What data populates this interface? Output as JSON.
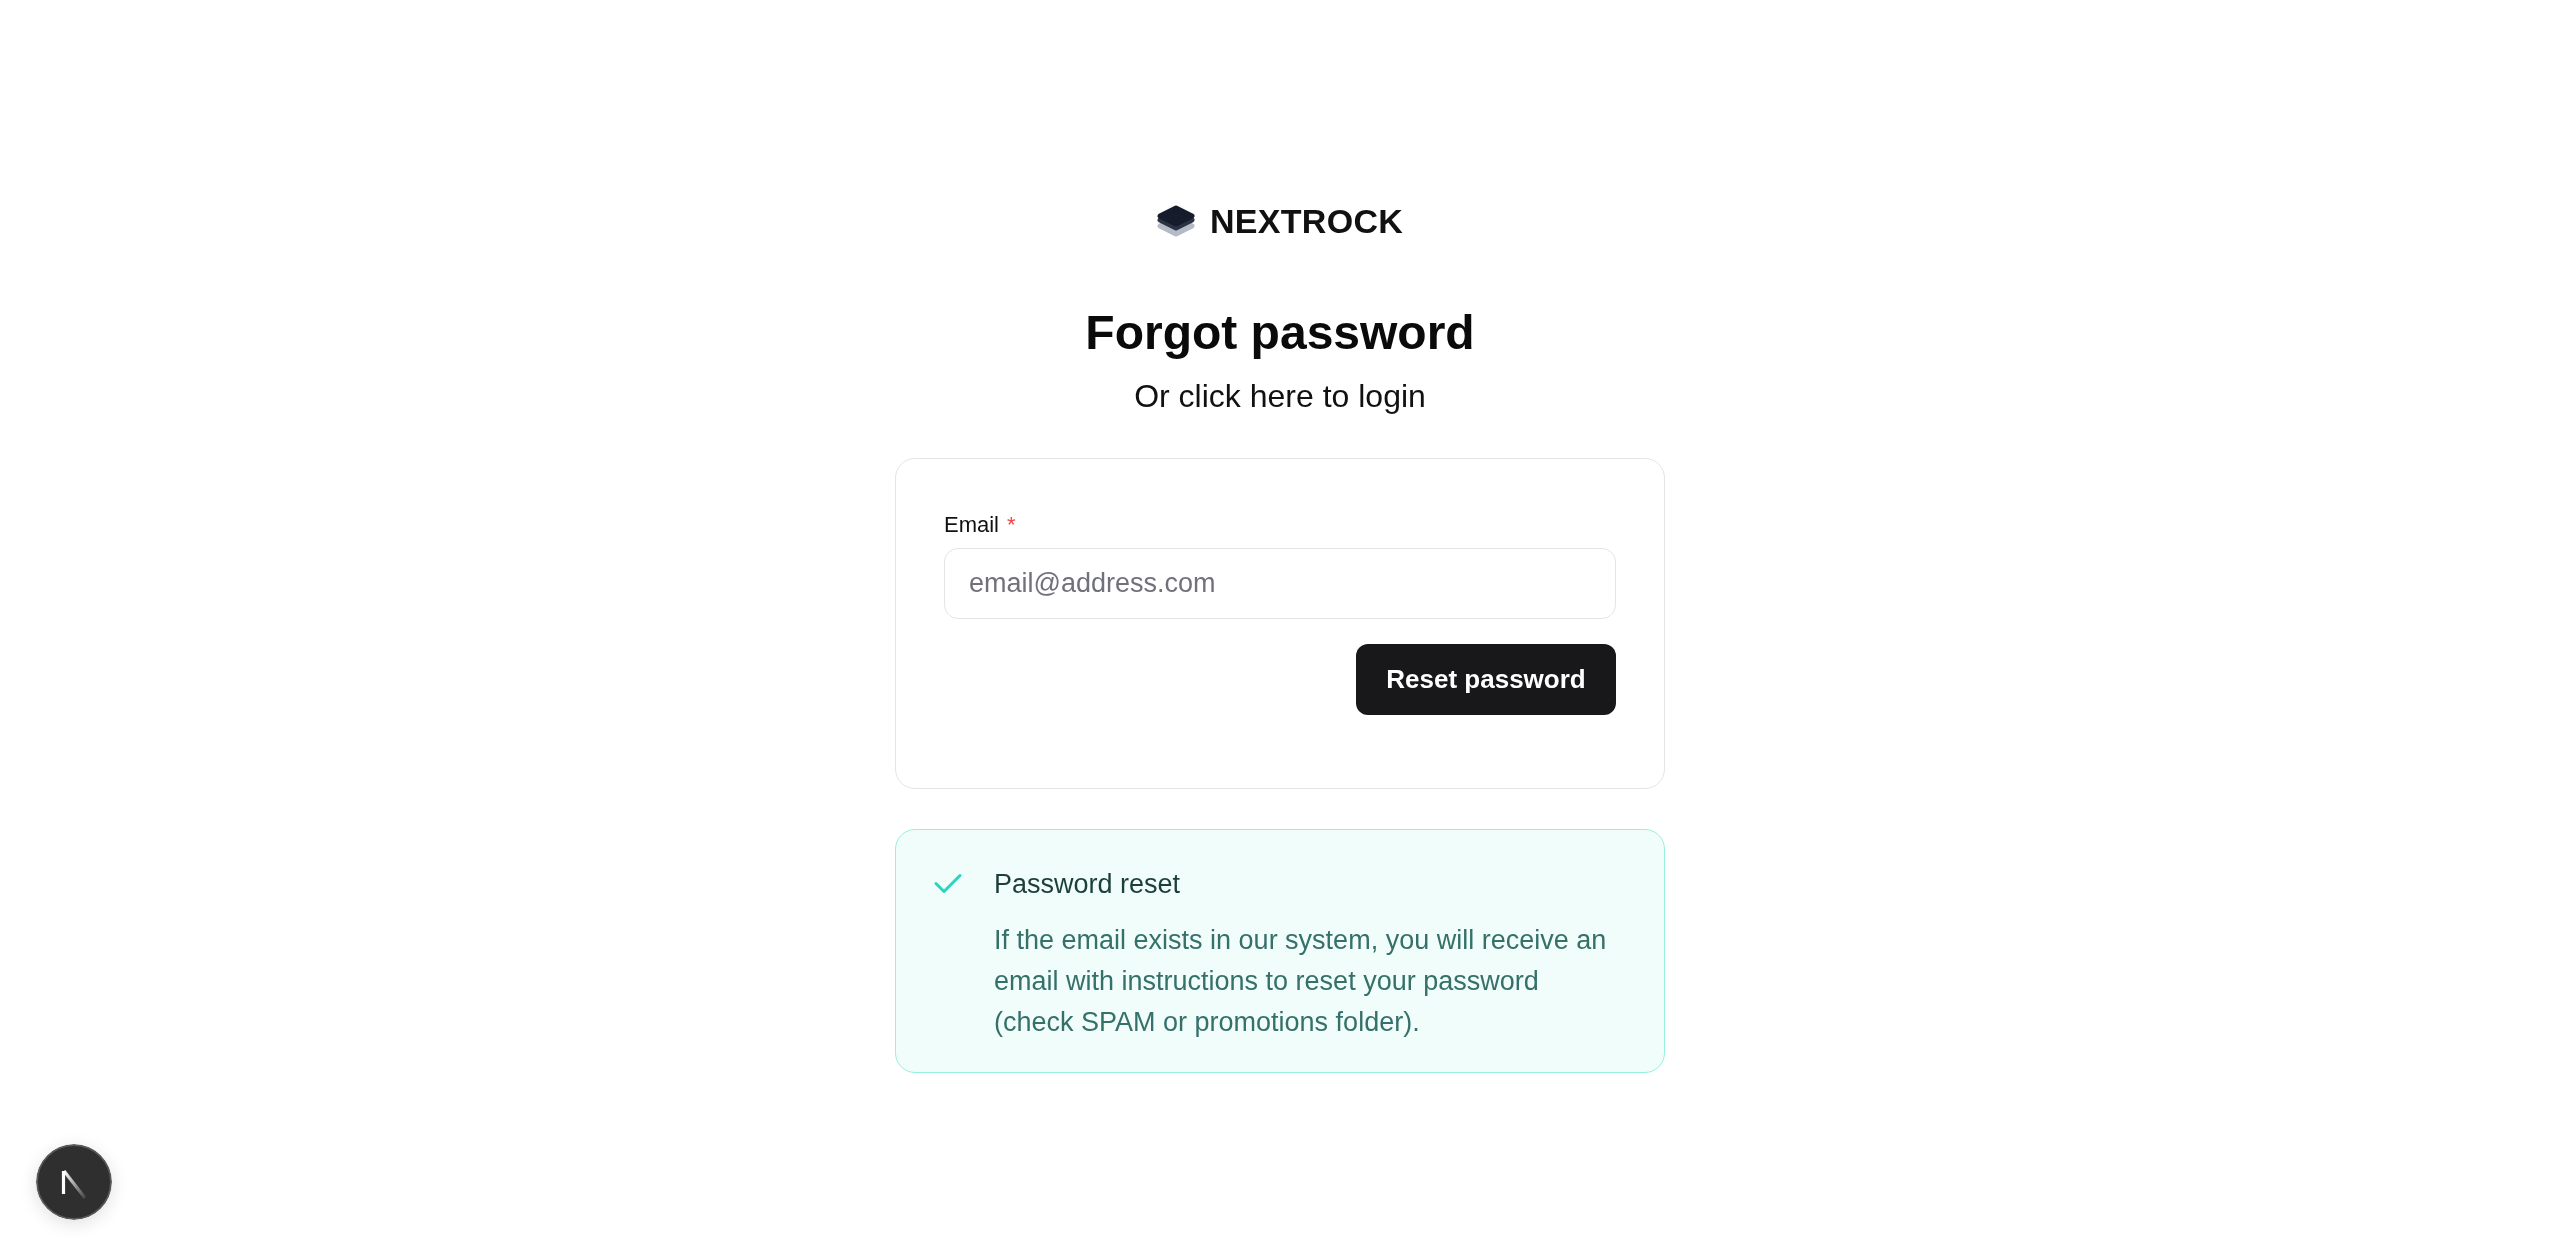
{
  "brand": {
    "name": "NEXTROCK"
  },
  "heading": "Forgot password",
  "subheading": "Or click here to login",
  "form": {
    "fields": [
      {
        "label": "Email",
        "required_mark": "*",
        "placeholder": "email@address.com"
      }
    ],
    "submit": "Reset password"
  },
  "alert": {
    "kind": "success",
    "title": "Password reset",
    "message": "If the email exists in our system, you will receive an email with instructions to reset your password (check SPAM or promotions folder)."
  }
}
